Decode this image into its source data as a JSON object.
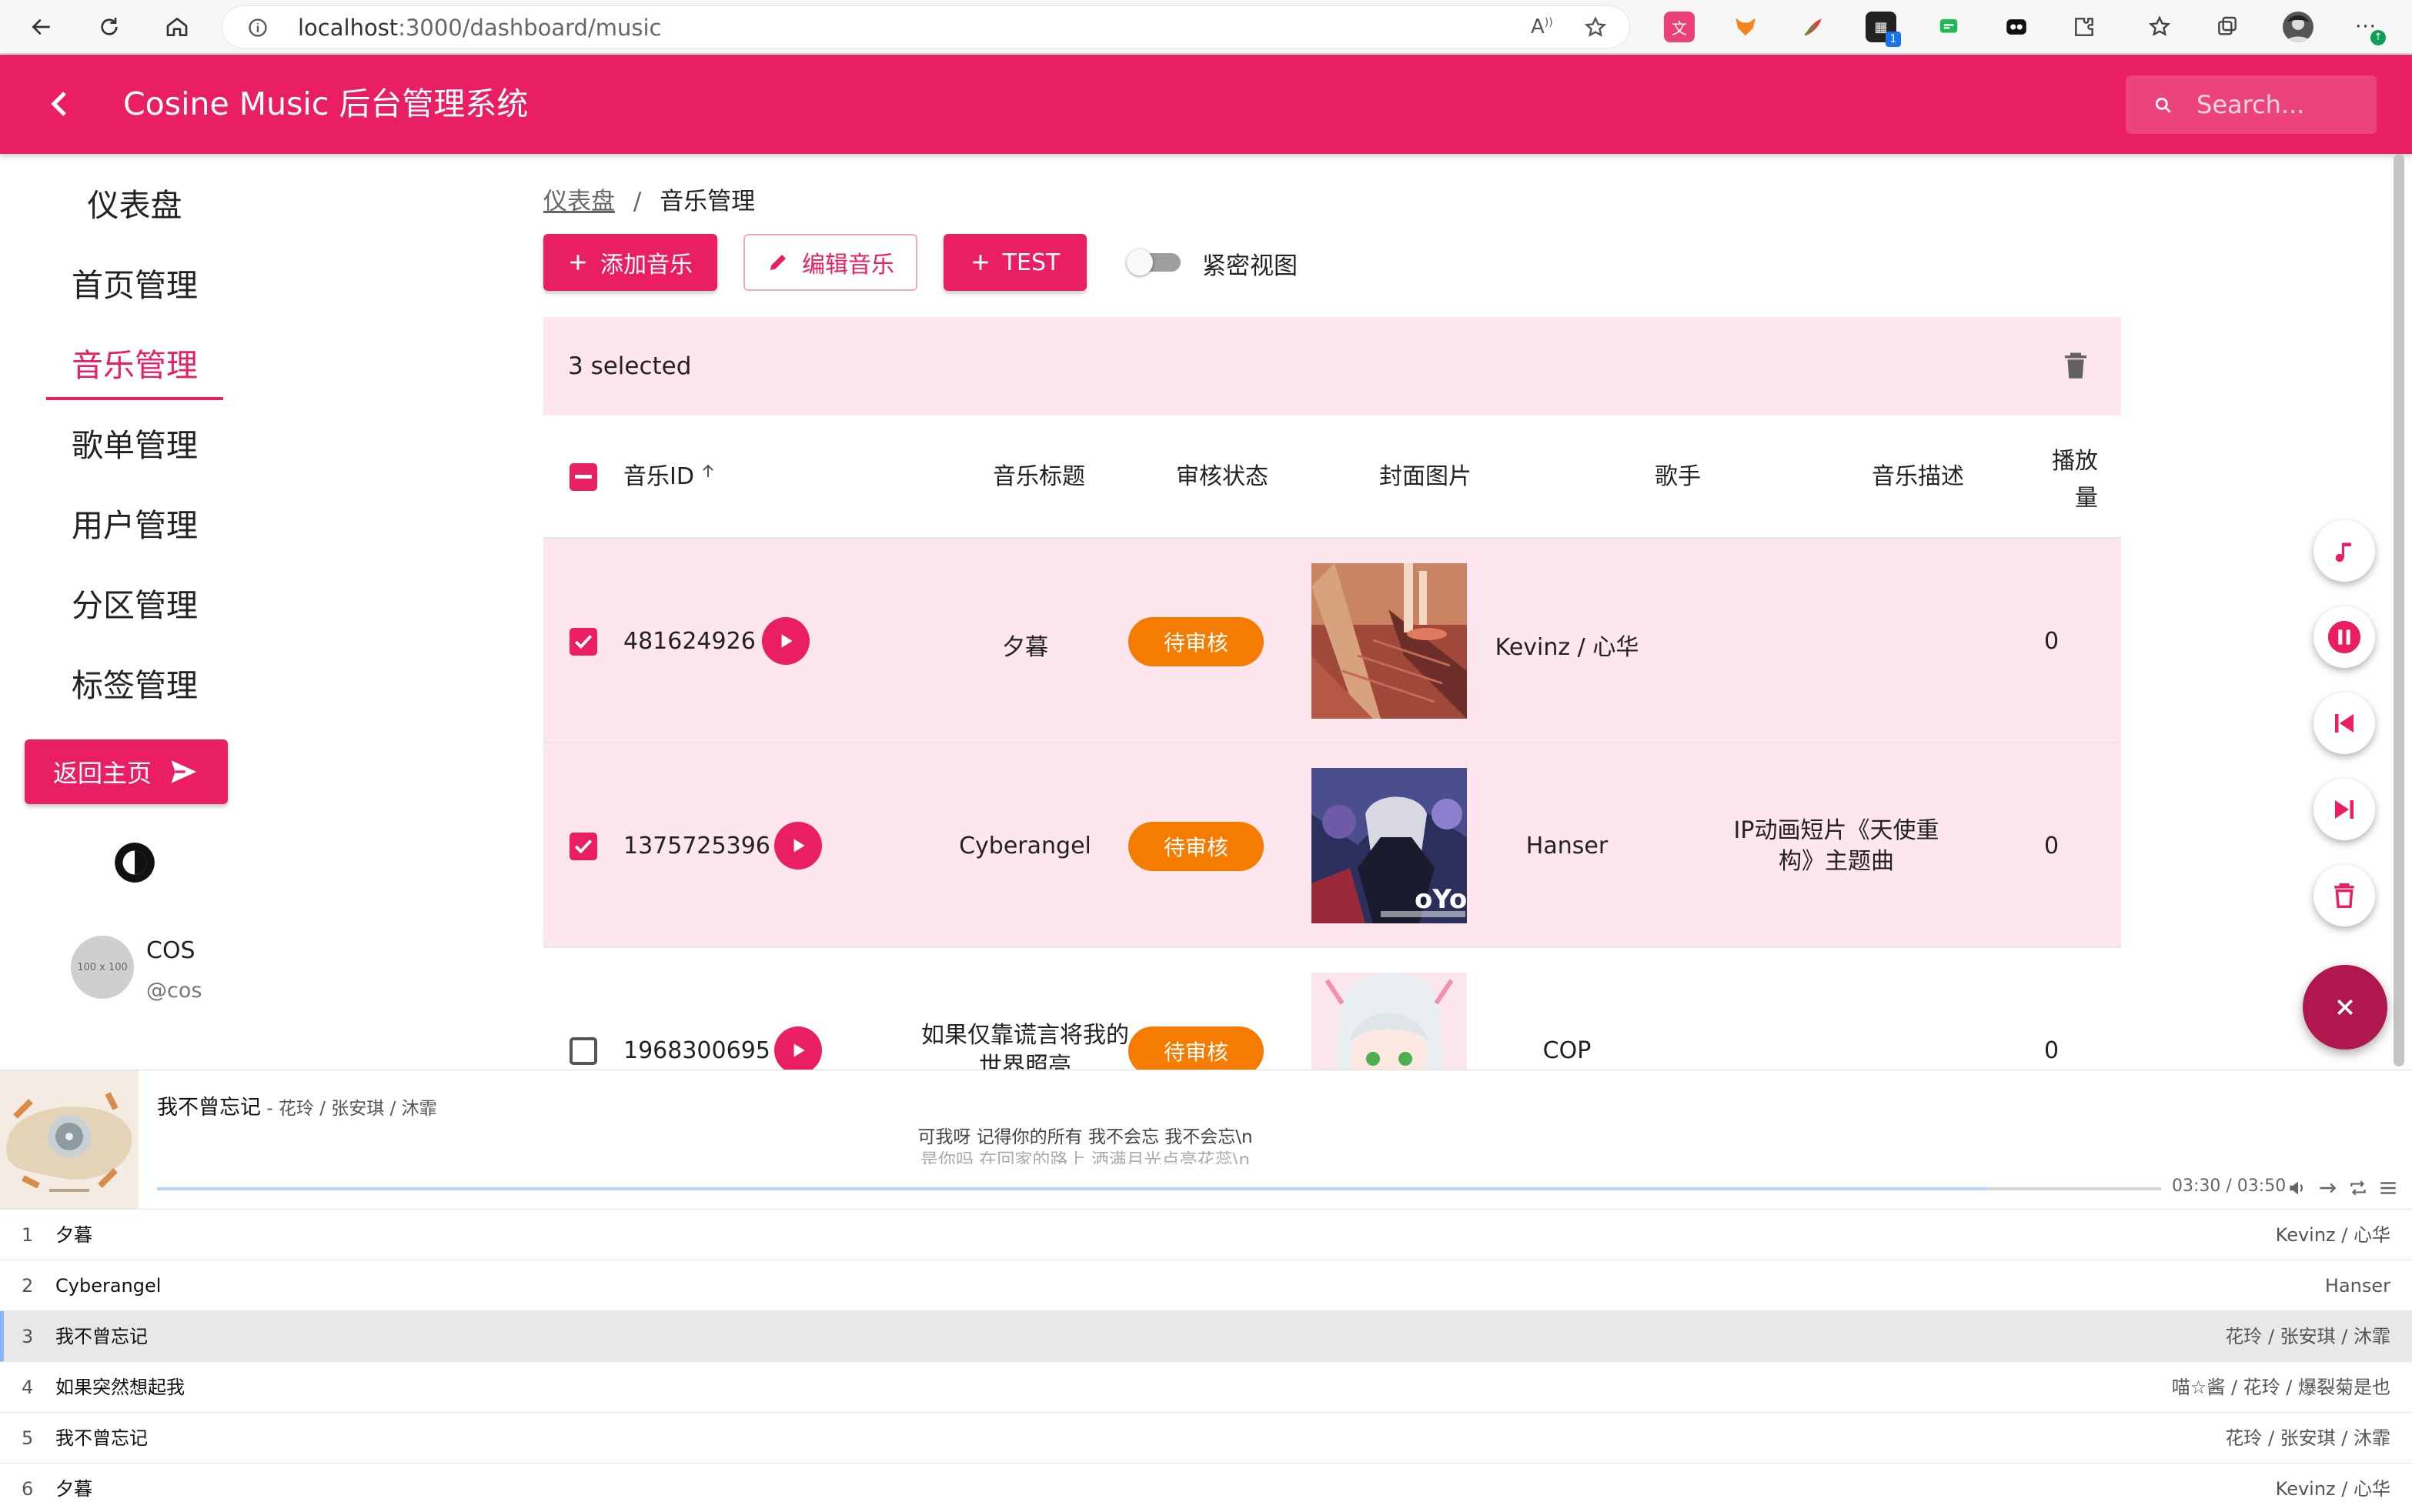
{
  "browser": {
    "url_host": "localhost",
    "url_rest": ":3000/dashboard/music"
  },
  "app": {
    "title": "Cosine Music 后台管理系统",
    "search_placeholder": "Search..."
  },
  "sidebar": {
    "items": [
      {
        "label": "仪表盘",
        "active": false
      },
      {
        "label": "首页管理",
        "active": false
      },
      {
        "label": "音乐管理",
        "active": true
      },
      {
        "label": "歌单管理",
        "active": false
      },
      {
        "label": "用户管理",
        "active": false
      },
      {
        "label": "分区管理",
        "active": false
      },
      {
        "label": "标签管理",
        "active": false
      }
    ],
    "home_button": "返回主页",
    "user": {
      "avatar_text": "100 x 100",
      "name": "COS",
      "handle": "@cos"
    }
  },
  "breadcrumb": {
    "root": "仪表盘",
    "separator": "/",
    "current": "音乐管理"
  },
  "toolbar": {
    "add": "添加音乐",
    "edit": "编辑音乐",
    "test": "TEST",
    "compact_toggle": "紧密视图",
    "compact_on": false
  },
  "selection": {
    "text": "3 selected"
  },
  "table": {
    "headers": {
      "id": "音乐ID",
      "title": "音乐标题",
      "status": "审核状态",
      "cover": "封面图片",
      "artist": "歌手",
      "desc": "音乐描述",
      "plays_line1": "播放",
      "plays_line2": "量"
    },
    "sort_column": "id",
    "sort_direction": "ascending",
    "rows": [
      {
        "id": "481624926",
        "title": "夕暮",
        "status": "待审核",
        "artist": "Kevinz / 心华",
        "desc_line1": "",
        "desc_line2": "",
        "plays": "0",
        "selected": true
      },
      {
        "id": "1375725396",
        "title": "Cyberangel",
        "status": "待审核",
        "artist": "Hanser",
        "desc_line1": "IP动画短片《天使重",
        "desc_line2": "构》主题曲",
        "plays": "0",
        "selected": true
      },
      {
        "id": "1968300695",
        "title": "如果仅靠谎言将我的",
        "title_line2": "世界照亮",
        "status": "待审核",
        "artist": "COP",
        "desc_line1": "",
        "desc_line2": "",
        "plays": "0",
        "selected": false
      }
    ]
  },
  "player": {
    "title": "我不曾忘记",
    "artist": " - 花玲 / 张安琪 / 沐霏",
    "lyric1": "可我呀 记得你的所有 我不会忘 我不会忘\\n",
    "lyric2": "是你吗 在回家的路上 洒满月光点亮花蕊\\n",
    "time": "03:30 / 03:50",
    "progress": 0.913,
    "playlist": [
      {
        "index": "1",
        "title": "夕暮",
        "artist": "Kevinz / 心华",
        "current": false
      },
      {
        "index": "2",
        "title": "Cyberangel",
        "artist": "Hanser",
        "current": false
      },
      {
        "index": "3",
        "title": "我不曾忘记",
        "artist": "花玲 / 张安琪 / 沐霏",
        "current": true
      },
      {
        "index": "4",
        "title": "如果突然想起我",
        "artist": "喵☆酱 / 花玲 / 爆裂菊是也",
        "current": false
      },
      {
        "index": "5",
        "title": "我不曾忘记",
        "artist": "花玲 / 张安琪 / 沐霏",
        "current": false
      },
      {
        "index": "6",
        "title": "夕暮",
        "artist": "Kevinz / 心华",
        "current": false
      }
    ]
  },
  "colors": {
    "primary": "#e91e63",
    "selected_row": "#fde6ee",
    "status_pending": "#f57c00",
    "fab_close": "#b0174f"
  }
}
